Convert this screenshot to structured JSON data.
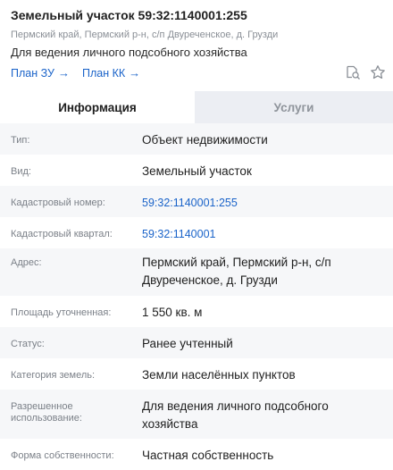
{
  "header": {
    "title": "Земельный участок 59:32:1140001:255",
    "subtitle": "Пермский край, Пермский р-н, с/п Двуреченское, д. Грузди",
    "purpose": "Для ведения личного подсобного хозяйства",
    "links": [
      {
        "label": "План ЗУ",
        "arrow": "→"
      },
      {
        "label": "План КК",
        "arrow": "→"
      }
    ],
    "icons": [
      "search-doc-icon",
      "star-icon"
    ]
  },
  "tabs": [
    {
      "label": "Информация",
      "active": true
    },
    {
      "label": "Услуги",
      "active": false
    }
  ],
  "rows": [
    {
      "label": "Тип:",
      "value": "Объект недвижимости"
    },
    {
      "label": "Вид:",
      "value": "Земельный участок"
    },
    {
      "label": "Кадастровый номер:",
      "value": "59:32:1140001:255",
      "link": true
    },
    {
      "label": "Кадастровый квартал:",
      "value": "59:32:1140001",
      "link": true
    },
    {
      "label": "Адрес:",
      "value": "Пермский край, Пермский р-н, с/п Двуреченское, д. Грузди"
    },
    {
      "label": "Площадь уточненная:",
      "value": "1 550 кв. м"
    },
    {
      "label": "Статус:",
      "value": "Ранее учтенный"
    },
    {
      "label": "Категория земель:",
      "value": "Земли населённых пунктов"
    },
    {
      "label": "Разрешенное использование:",
      "value": "Для ведения личного подсобного хозяйства"
    },
    {
      "label": "Форма собственности:",
      "value": "Частная собственность"
    }
  ],
  "colors": {
    "link": "#1a63c9",
    "stripe": "#f6f7f9",
    "tab_inactive_bg": "#eceef3"
  }
}
